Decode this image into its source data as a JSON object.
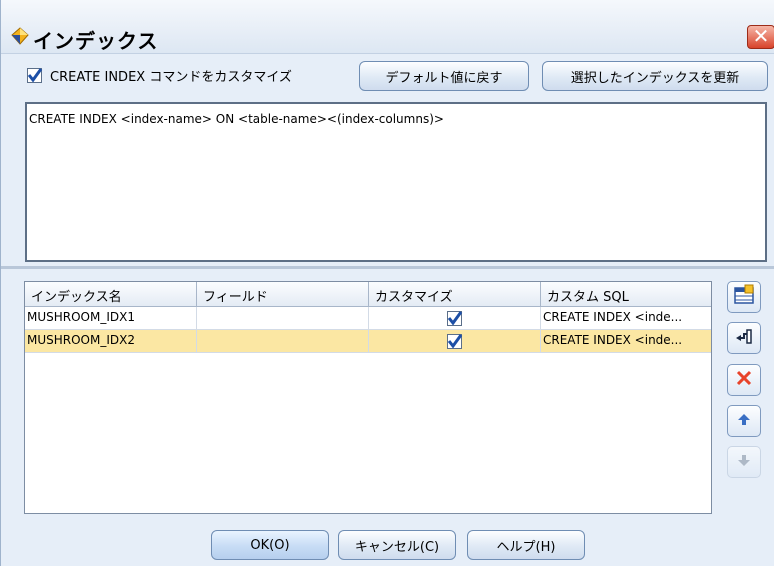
{
  "window": {
    "title": "インデックス",
    "close_icon": "close-icon"
  },
  "customize": {
    "checked": true,
    "label": "CREATE INDEX コマンドをカスタマイズ"
  },
  "buttons": {
    "reset_default": "デフォルト値に戻す",
    "update_selected": "選択したインデックスを更新",
    "ok": "OK(O)",
    "cancel": "キャンセル(C)",
    "help": "ヘルプ(H)"
  },
  "editor": {
    "text": "CREATE INDEX <index-name> ON <table-name><(index-columns)>"
  },
  "table": {
    "columns": [
      "インデックス名",
      "フィールド",
      "カスタマイズ",
      "カスタム SQL"
    ],
    "rows": [
      {
        "name": "MUSHROOM_IDX1",
        "field": "",
        "customize": true,
        "sql": "CREATE INDEX <inde...",
        "selected": false
      },
      {
        "name": "MUSHROOM_IDX2",
        "field": "",
        "customize": true,
        "sql": "CREATE INDEX <inde...",
        "selected": true
      }
    ]
  },
  "side_buttons": [
    {
      "icon": "add-index-icon",
      "enabled": true
    },
    {
      "icon": "move-to-bottom-icon",
      "enabled": true
    },
    {
      "icon": "delete-icon",
      "enabled": true
    },
    {
      "icon": "move-up-icon",
      "enabled": true
    },
    {
      "icon": "move-down-icon",
      "enabled": false
    }
  ],
  "colors": {
    "selected_row": "#fbe7a3",
    "delete": "#e8432a",
    "accent": "#3a6fc4"
  }
}
